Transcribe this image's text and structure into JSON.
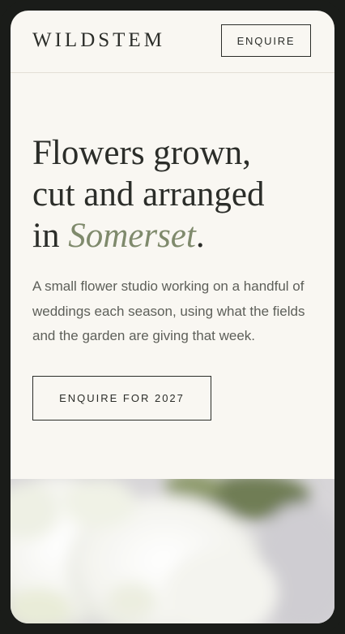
{
  "header": {
    "brand": "WILDSTEM",
    "enquire_label": "ENQUIRE"
  },
  "hero": {
    "headline_line1": "Flowers grown,",
    "headline_line2": "cut and arranged",
    "headline_line3_prefix": "in ",
    "headline_accent": "Somerset",
    "headline_suffix": ".",
    "lede": "A small flower studio working on a handful of weddings each season, using what the fields and the garden are giving that week.",
    "cta_label": "ENQUIRE FOR 2027"
  },
  "colors": {
    "background": "#f9f7f2",
    "ink": "#2b2d29",
    "accent": "#7f8a6c",
    "muted_text": "#5d5f59",
    "frame": "#1a1c19"
  },
  "photo": {
    "icon": "white-flowers-photo"
  }
}
